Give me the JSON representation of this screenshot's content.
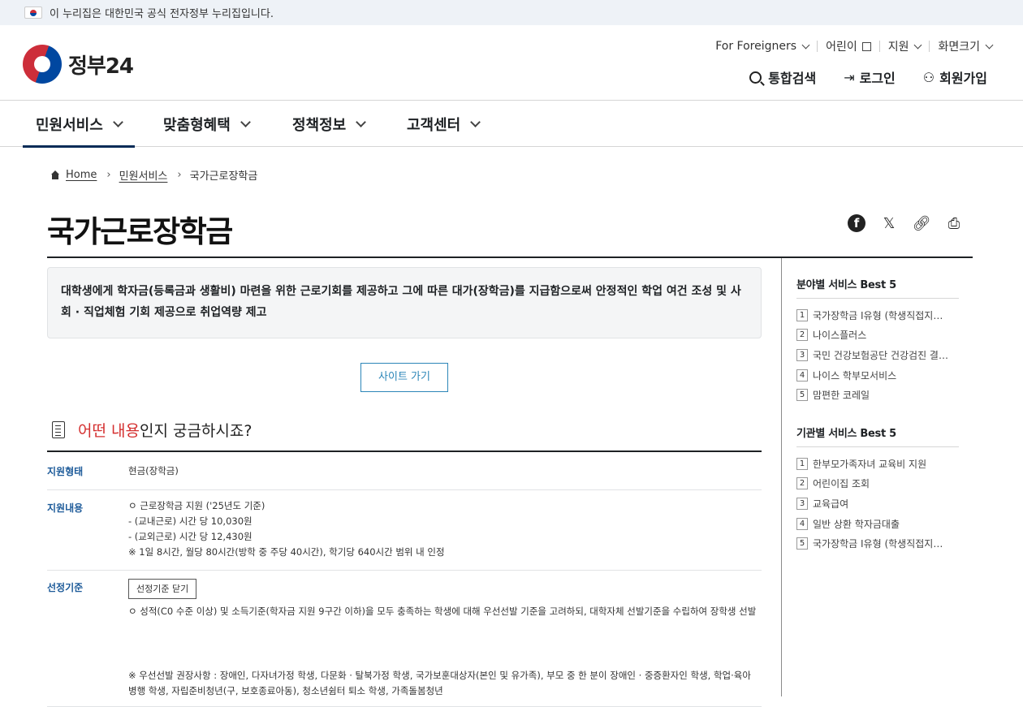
{
  "banner": {
    "text": "이 누리집은 대한민국 공식 전자정부 누리집입니다."
  },
  "logo": {
    "text": "정부24"
  },
  "util_top": [
    {
      "label": "For Foreigners",
      "icon": "chevron-down-icon"
    },
    {
      "label": "어린이",
      "icon": "external-link-icon"
    },
    {
      "label": "지원",
      "icon": "chevron-down-icon"
    },
    {
      "label": "화면크기",
      "icon": "chevron-down-icon"
    }
  ],
  "util_main": {
    "search": "통합검색",
    "login": "로그인",
    "signup": "회원가입"
  },
  "gnb": [
    "민원서비스",
    "맞춤형혜택",
    "정책정보",
    "고객센터"
  ],
  "breadcrumb": {
    "home": "Home",
    "level1": "민원서비스",
    "current": "국가근로장학금"
  },
  "page": {
    "title": "국가근로장학금",
    "summary": "대학생에게 학자금(등록금과 생활비) 마련을 위한 근로기회를 제공하고 그에 따른 대가(장학금)를 지급함으로써 안정적인 학업 여건 조성 및 사회 · 직업체험 기회 제공으로 취업역량 제고",
    "site_button": "사이트 가기",
    "section_title_highlight": "어떤 내용",
    "section_title_rest": "인지 궁금하시죠?"
  },
  "details": {
    "r1_label": "지원형태",
    "r1_value": "현금(장학금)",
    "r2_label": "지원내용",
    "r2_lines": [
      "ㅇ 근로장학금 지원 ('25년도 기준)",
      " - (교내근로) 시간 당 10,030원",
      " - (교외근로) 시간 당 12,430원",
      "  ※ 1일 8시간, 월당 80시간(방학 중 주당 40시간), 학기당 640시간 범위 내 인정"
    ],
    "r3_label": "선정기준",
    "r3_button": "선정기준 닫기",
    "r3_line": "ㅇ 성적(C0 수준 이상) 및 소득기준(학자금 지원 9구간 이하)을 모두 충족하는 학생에 대해 우선선발 기준을 고려하되, 대학자체 선발기준을 수립하여 장학생 선발",
    "r3_note": " ※ 우선선발 권장사항 : 장애인, 다자녀가정 학생, 다문화 · 탈북가정 학생, 국가보훈대상자(본인 및 유가족), 부모 중 한 분이 장애인 · 중증환자인 학생, 학업·육아 병행 학생, 자립준비청년(구, 보호종료아동), 청소년쉼터 퇴소 학생, 가족돌봄청년"
  },
  "side": {
    "field_title": "분야별 서비스 Best 5",
    "field_items": [
      "국가장학금 Ⅰ유형 (학생직접지…",
      "나이스플러스",
      "국민 건강보험공단 건강검진 결…",
      "나이스 학부모서비스",
      "맘편한 코레일"
    ],
    "agency_title": "기관별 서비스 Best 5",
    "agency_items": [
      "한부모가족자녀 교육비 지원",
      "어린이집 조회",
      "교육급여",
      "일반 상환 학자금대출",
      "국가장학금 Ⅰ유형 (학생직접지…"
    ]
  },
  "numbers": [
    "1",
    "2",
    "3",
    "4",
    "5"
  ],
  "share_icons": [
    "facebook-icon",
    "x-icon",
    "link-icon",
    "print-icon"
  ]
}
